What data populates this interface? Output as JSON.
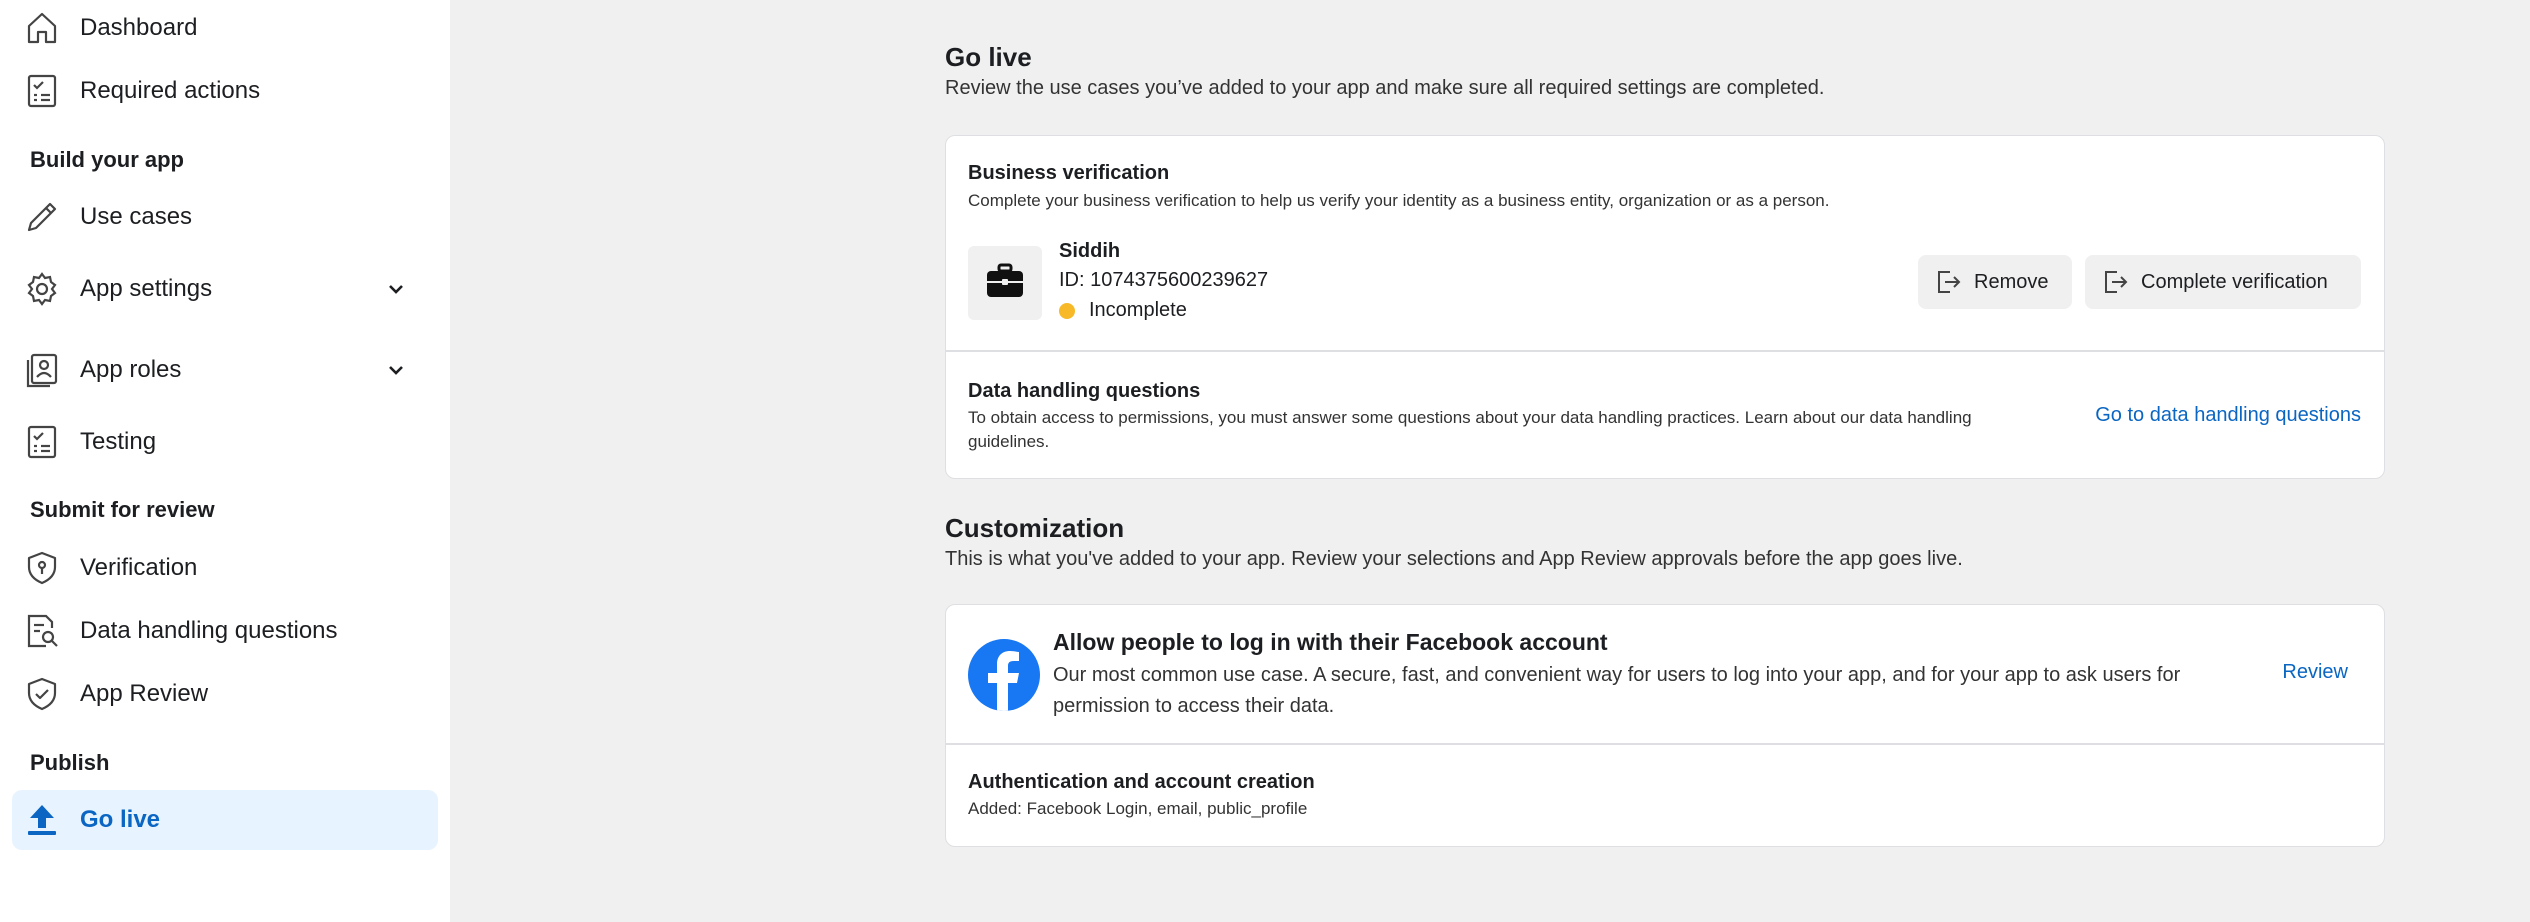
{
  "sidebar": {
    "dashboard": "Dashboard",
    "required_actions": "Required actions",
    "build_section": "Build your app",
    "use_cases": "Use cases",
    "app_settings": "App settings",
    "app_roles": "App roles",
    "testing": "Testing",
    "submit_section": "Submit for review",
    "verification": "Verification",
    "data_handling": "Data handling questions",
    "app_review": "App Review",
    "publish_section": "Publish",
    "go_live": "Go live"
  },
  "golive": {
    "title": "Go live",
    "description": "Review the use cases you’ve added to your app and make sure all required settings are completed."
  },
  "business": {
    "title": "Business verification",
    "description": "Complete your business verification to help us verify your identity as a business entity, organization or as a person.",
    "name": "Siddih",
    "id_text": "ID: 1074375600239627",
    "status": "Incomplete",
    "remove_label": "Remove",
    "complete_label": "Complete verification"
  },
  "data_handling": {
    "title": "Data handling questions",
    "description": "To obtain access to permissions, you must answer some questions about your data handling practices. Learn about our data handling guidelines.",
    "link": "Go to data handling questions"
  },
  "customization": {
    "title": "Customization",
    "description": "This is what you've added to your app. Review your selections and App Review approvals before the app goes live."
  },
  "login_case": {
    "title": "Allow people to log in with their Facebook account",
    "description": "Our most common use case. A secure, fast, and convenient way for users to log into your app, and for your app to ask users for permission to access their data.",
    "review": "Review",
    "auth_title": "Authentication and account creation",
    "auth_added": "Added: Facebook Login, email, public_profile"
  },
  "colors": {
    "accent": "#0a66c2",
    "active_bg": "#e7f3ff",
    "facebook_blue": "#1877f2",
    "status_yellow": "#f7b928"
  }
}
